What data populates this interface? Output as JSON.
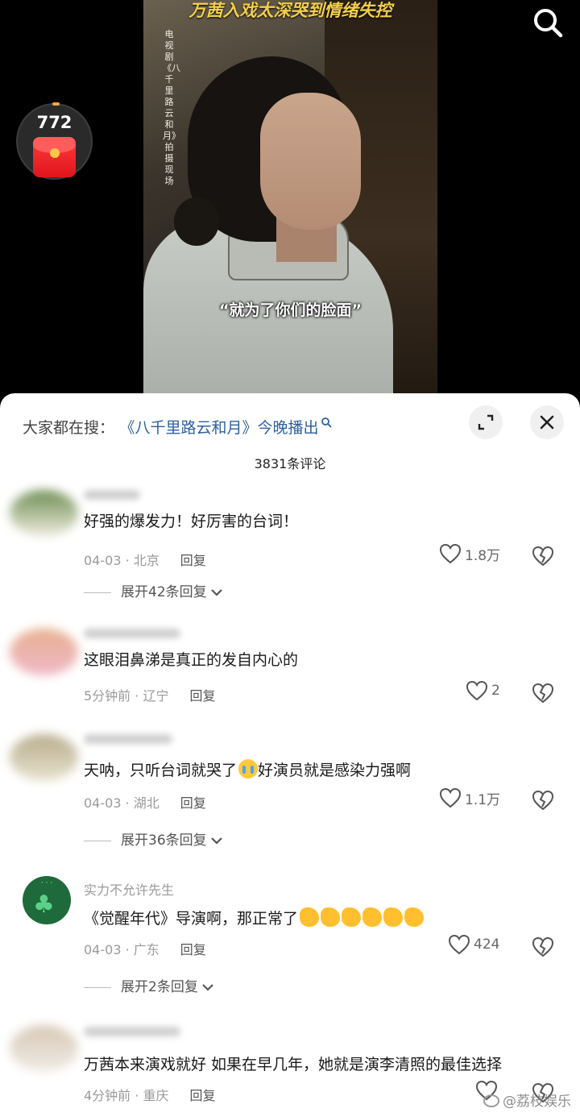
{
  "video": {
    "title": "万茜入戏太深哭到情绪失控",
    "vertical_note": "电视剧《八千里路云和月》拍摄现场",
    "subtitle": "“就为了你们的脸面”"
  },
  "redpacket": {
    "count": "772"
  },
  "sheet": {
    "trending_label": "大家都在搜：",
    "trending_link": "《八千里路云和月》今晚播出",
    "comment_count": "3831条评论"
  },
  "comments": [
    {
      "text": "好强的爆发力！好厉害的台词！",
      "date": "04-03",
      "location": "北京",
      "reply": "回复",
      "likes": "1.8万",
      "expand": "展开42条回复"
    },
    {
      "text": "这眼泪鼻涕是真正的发自内心的",
      "date": "5分钟前",
      "location": "辽宁",
      "reply": "回复",
      "likes": "2"
    },
    {
      "text_before": "天呐，只听台词就哭了",
      "text_after": "好演员就是感染力强啊",
      "date": "04-03",
      "location": "湖北",
      "reply": "回复",
      "likes": "1.1万",
      "expand": "展开36条回复"
    },
    {
      "username": "实力不允许先生",
      "text": "《觉醒年代》导演啊，那正常了",
      "date": "04-03",
      "location": "广东",
      "reply": "回复",
      "likes": "424",
      "expand": "展开2条回复"
    },
    {
      "text": "万茜本来演戏就好 如果在早几年，她就是演李清照的最佳选择",
      "date": "4分钟前",
      "location": "重庆",
      "reply": "回复"
    }
  ],
  "watermark": "@荔枝娱乐",
  "icons": [
    "search-icon",
    "red-packet-icon",
    "expand-icon",
    "close-icon",
    "heart-icon",
    "broken-heart-icon",
    "chevron-down-icon",
    "crying-emoji",
    "clapping-emoji"
  ]
}
